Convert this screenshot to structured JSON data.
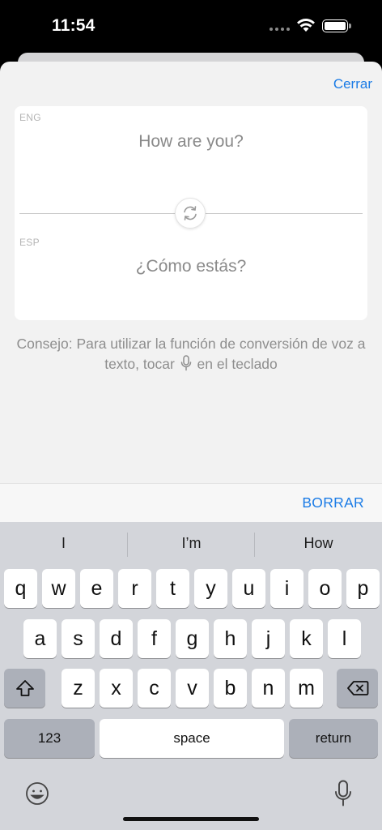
{
  "status_bar": {
    "time": "11:54"
  },
  "sheet": {
    "close_label": "Cerrar",
    "source_lang": "ENG",
    "source_text": "How are you?",
    "target_lang": "ESP",
    "target_text": "¿Cómo estás?",
    "tip_before": "Consejo: Para utilizar la función de conversión de voz a texto, tocar",
    "tip_after": "en el teclado"
  },
  "accessory": {
    "clear_label": "BORRAR"
  },
  "keyboard": {
    "suggestions": [
      "I",
      "I’m",
      "How"
    ],
    "row1": [
      "q",
      "w",
      "e",
      "r",
      "t",
      "y",
      "u",
      "i",
      "o",
      "p"
    ],
    "row2": [
      "a",
      "s",
      "d",
      "f",
      "g",
      "h",
      "j",
      "k",
      "l"
    ],
    "row3": [
      "z",
      "x",
      "c",
      "v",
      "b",
      "n",
      "m"
    ],
    "numbers_label": "123",
    "space_label": "space",
    "return_label": "return"
  },
  "icons": [
    "wifi-icon",
    "battery-icon",
    "swap-icon",
    "microphone-icon",
    "shift-icon",
    "delete-icon",
    "emoji-icon",
    "dictation-icon"
  ],
  "colors": {
    "accent": "#1a7be6",
    "sheet_bg": "#f2f2f2",
    "keyboard_bg": "#d3d5da"
  }
}
